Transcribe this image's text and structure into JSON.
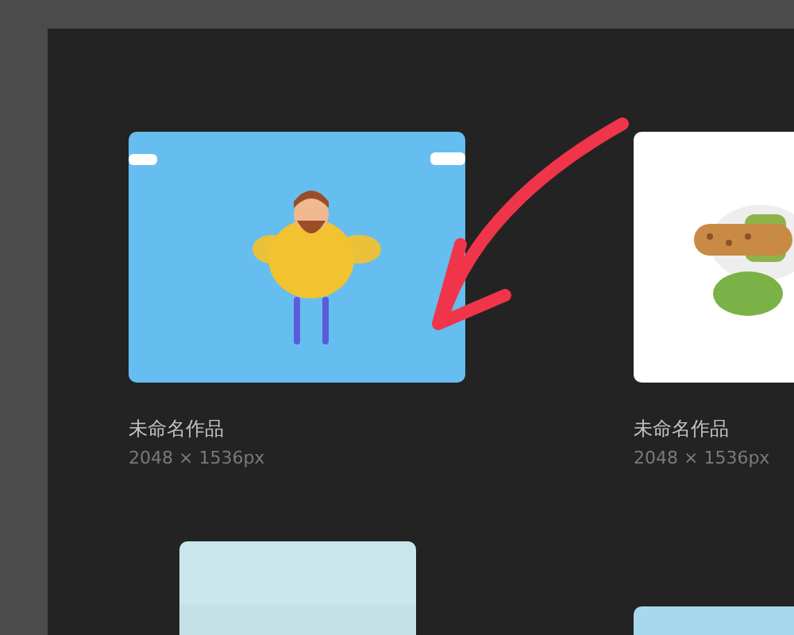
{
  "artworks": [
    {
      "title": "未命名作品",
      "size": "2048 × 1536px",
      "kind": "picture"
    },
    {
      "title": "未命名作品",
      "size": "2048 × 1536px",
      "kind": "picture"
    }
  ]
}
